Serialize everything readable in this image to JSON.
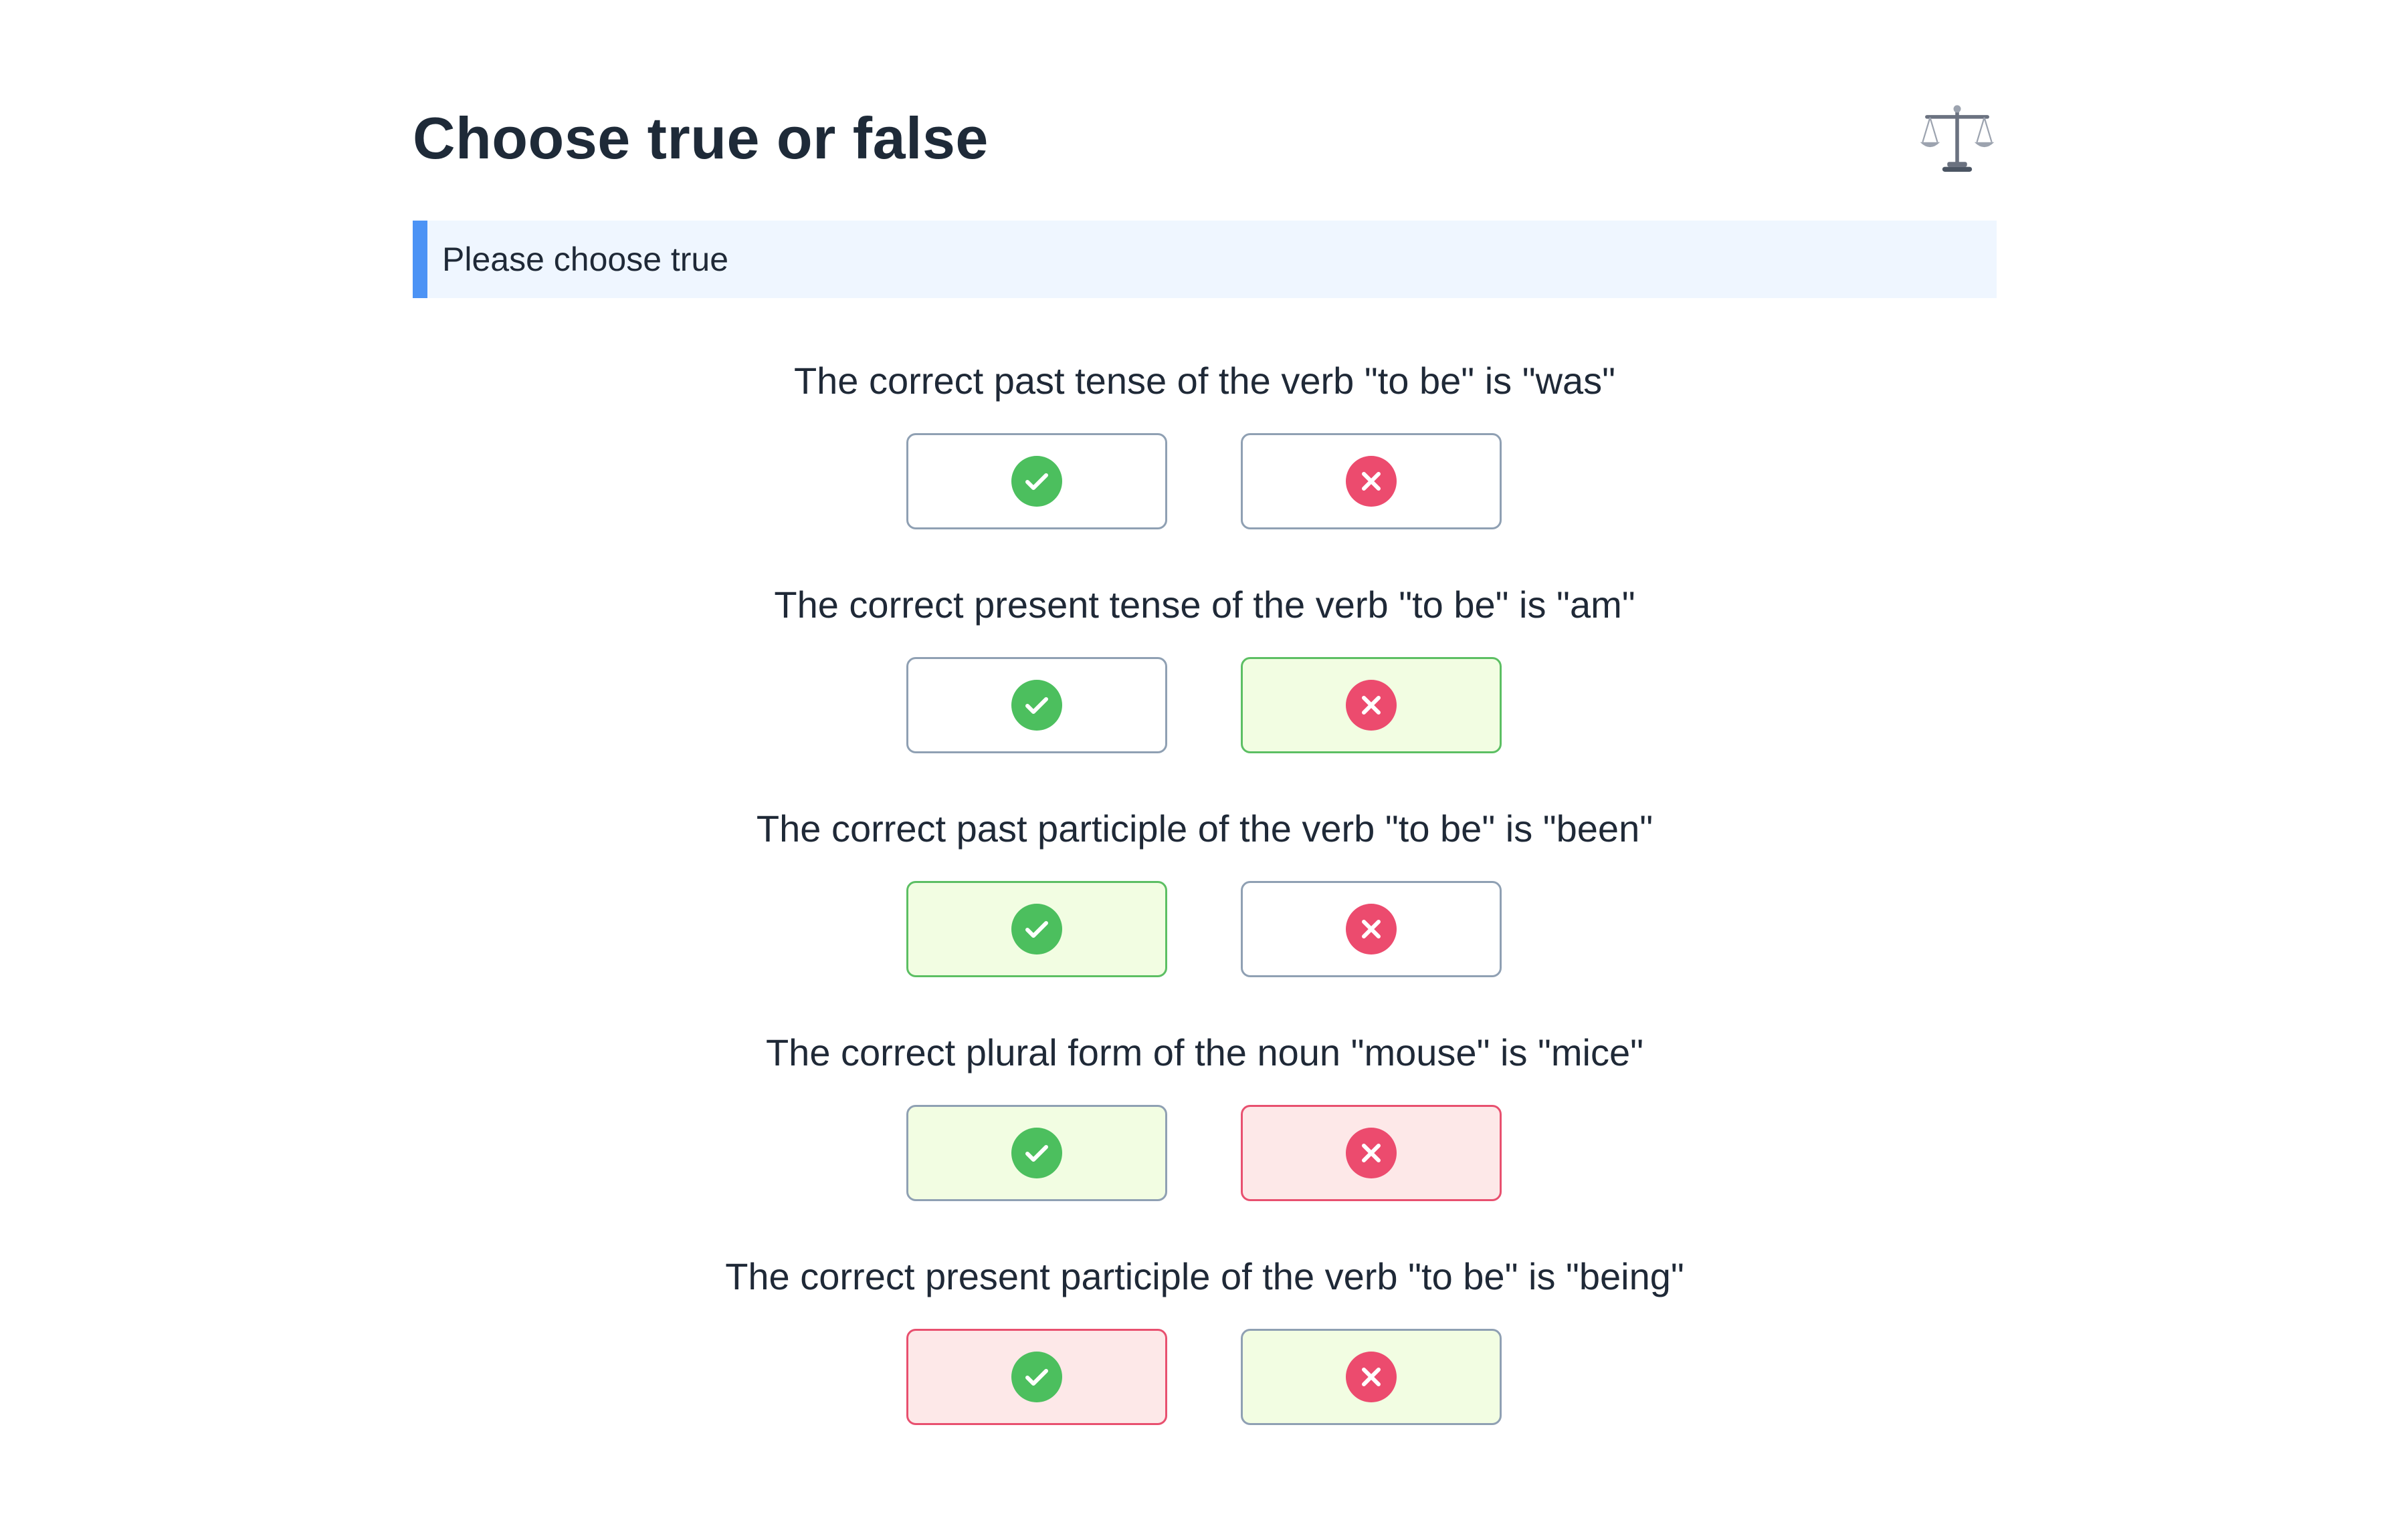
{
  "header": {
    "title": "Choose true or false",
    "icon": "balance-scale-icon"
  },
  "instruction": {
    "text": "Please choose true",
    "accent_color": "#4c93f5"
  },
  "colors": {
    "true_icon": "#4cbf5e",
    "false_icon": "#ec4b6e",
    "selected_green_bg": "#f2fde2",
    "selected_red_bg": "#fde8e8"
  },
  "questions": [
    {
      "text": "The correct past tense of the verb \"to be\" is \"was\"",
      "true_state": "neutral",
      "false_state": "neutral"
    },
    {
      "text": "The correct present tense of the verb \"to be\" is \"am\"",
      "true_state": "neutral",
      "false_state": "green"
    },
    {
      "text": "The correct past participle of the verb \"to be\" is \"been\"",
      "true_state": "green",
      "false_state": "neutral"
    },
    {
      "text": "The correct plural form of the noun \"mouse\" is \"mice\"",
      "true_state": "green-soft",
      "false_state": "red"
    },
    {
      "text": "The correct present participle of the verb \"to be\" is \"being\"",
      "true_state": "red",
      "false_state": "green-soft"
    }
  ]
}
